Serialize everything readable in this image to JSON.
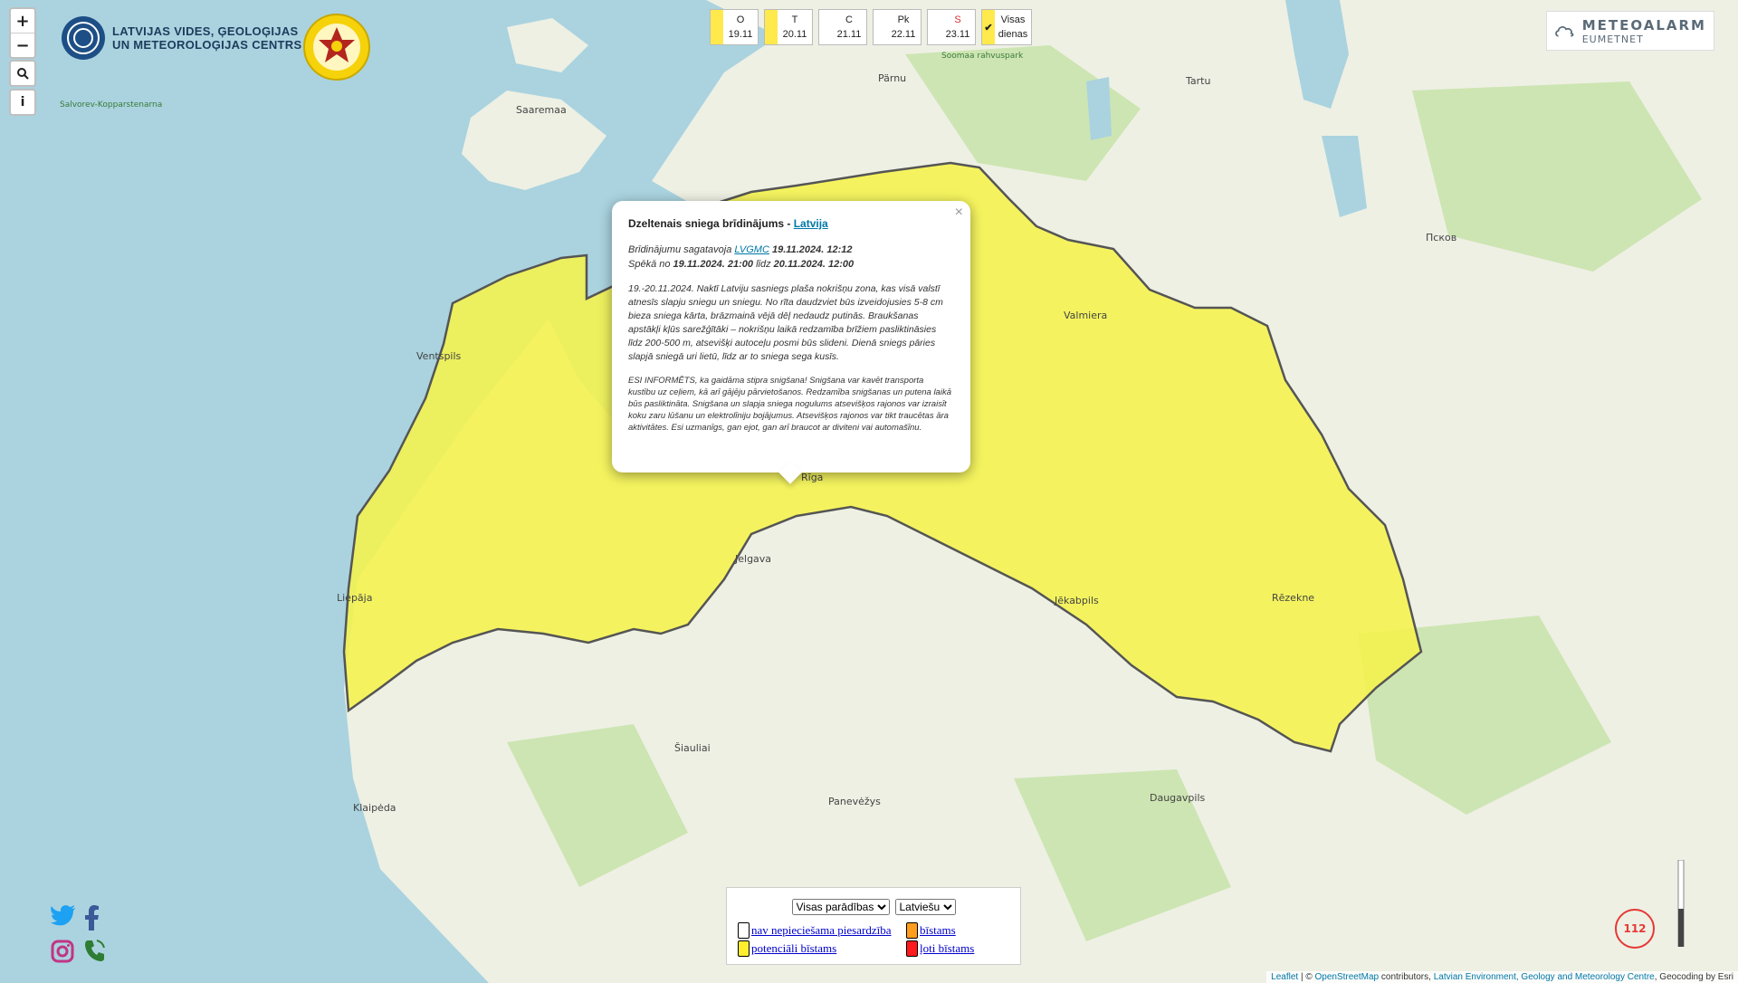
{
  "map": {
    "colors": {
      "water": "#aad3df",
      "land": "#eef0e4",
      "forest": "#cde5b2",
      "warning_yellow": "#f5f24c",
      "border": "#555555"
    },
    "places": [
      "Saaremaa",
      "Pärnu",
      "Tartu",
      "Valmiera",
      "Ventspils",
      "Rīga",
      "Liepāja",
      "Jelgava",
      "Jēkabpils",
      "Rēzekne",
      "Daugavpils",
      "Klaipėda",
      "Šiauliai",
      "Panevėžys",
      "Псков",
      "Soomaa rahvuspark",
      "Salvorev-Kopparstenarna",
      "Latvijas Vides, Ģeoloģijas"
    ]
  },
  "controls": {
    "zoom_in": "+",
    "zoom_out": "−",
    "search_icon": "search-icon",
    "info": "i"
  },
  "logo": {
    "line1": "LATVIJAS VIDES, ĢEOLOĢIJAS",
    "line2": "UN METEOROLOĢIJAS CENTRS"
  },
  "days": [
    {
      "letter": "O",
      "date": "19.11",
      "color": "#ffe94d"
    },
    {
      "letter": "T",
      "date": "20.11",
      "color": "#ffe94d"
    },
    {
      "letter": "C",
      "date": "21.11",
      "color": "#ffffff"
    },
    {
      "letter": "Pk",
      "date": "22.11",
      "color": "#ffffff"
    },
    {
      "letter": "S",
      "date": "23.11",
      "color": "#ffffff"
    }
  ],
  "all_days": {
    "line1": "Visas",
    "line2": "dienas",
    "check": "✔"
  },
  "meteoalarm": {
    "name": "METEOALARM",
    "sub": "EUMETNET"
  },
  "popup": {
    "title": "Dzeltenais sniega brīdinājums - ",
    "title_link": "Latvija",
    "meta1": "Brīdinājumu sagatavoja ",
    "meta1_link": "LVGMC",
    "meta1_time": " 19.11.2024. 12:12",
    "meta2_prefix": "Spēkā no ",
    "meta2_from": "19.11.2024. 21:00",
    "meta2_mid": " līdz ",
    "meta2_to": "20.11.2024. 12:00",
    "body1": "19.-20.11.2024. Naktī Latviju sasniegs plaša nokrišņu zona, kas visā valstī atnesīs slapju sniegu un sniegu. No rīta daudzviet būs izveidojusies 5-8 cm bieza sniega kārta, brāzmainā vējā dēļ nedaudz putinās. Braukšanas apstākļi kļūs sarežģītāki – nokrišņu laikā redzamība brīžiem pasliktināsies līdz 200-500 m, atsevišķi autoceļu posmi būs slideni. Dienā sniegs pāries slapjā sniegā uri lietū, līdz ar to sniega sega kusīs.",
    "body2": "ESI INFORMĒTS, ka gaidāma stipra snigšana! Snigšana var kavēt transporta kustību uz ceļiem, kā arī gājēju pārvietošanos. Redzamība snigšanas un putena laikā būs pasliktināta. Snigšana un slapja sniega nogulums atsevišķos rajonos var izraisīt koku zaru lūšanu un elektrolīniju bojājumus. Atsevišķos rajonos var tikt traucētas āra aktivitātes. Esi uzmanīgs, gan ejot, gan arī braucot ar diviteni vai automašīnu.",
    "close": "×"
  },
  "legend": {
    "select1": "Visas parādības",
    "select2": "Latviešu",
    "items": [
      {
        "label": "nav nepieciešama piesardzība",
        "color": "#ffffff"
      },
      {
        "label": "bīstams",
        "color": "#ff9d1c"
      },
      {
        "label": "potenciāli bīstams",
        "color": "#ffed2e"
      },
      {
        "label": "ļoti bīstams",
        "color": "#ff1b1b"
      }
    ]
  },
  "emergency": "112",
  "attribution": {
    "leaflet": "Leaflet",
    "sep": " | © ",
    "osm": "OpenStreetMap",
    "mid": " contributors, ",
    "lvgmc": "Latvian Environment, Geology and Meteorology Centre",
    "end": ", Geocoding by Esri"
  }
}
